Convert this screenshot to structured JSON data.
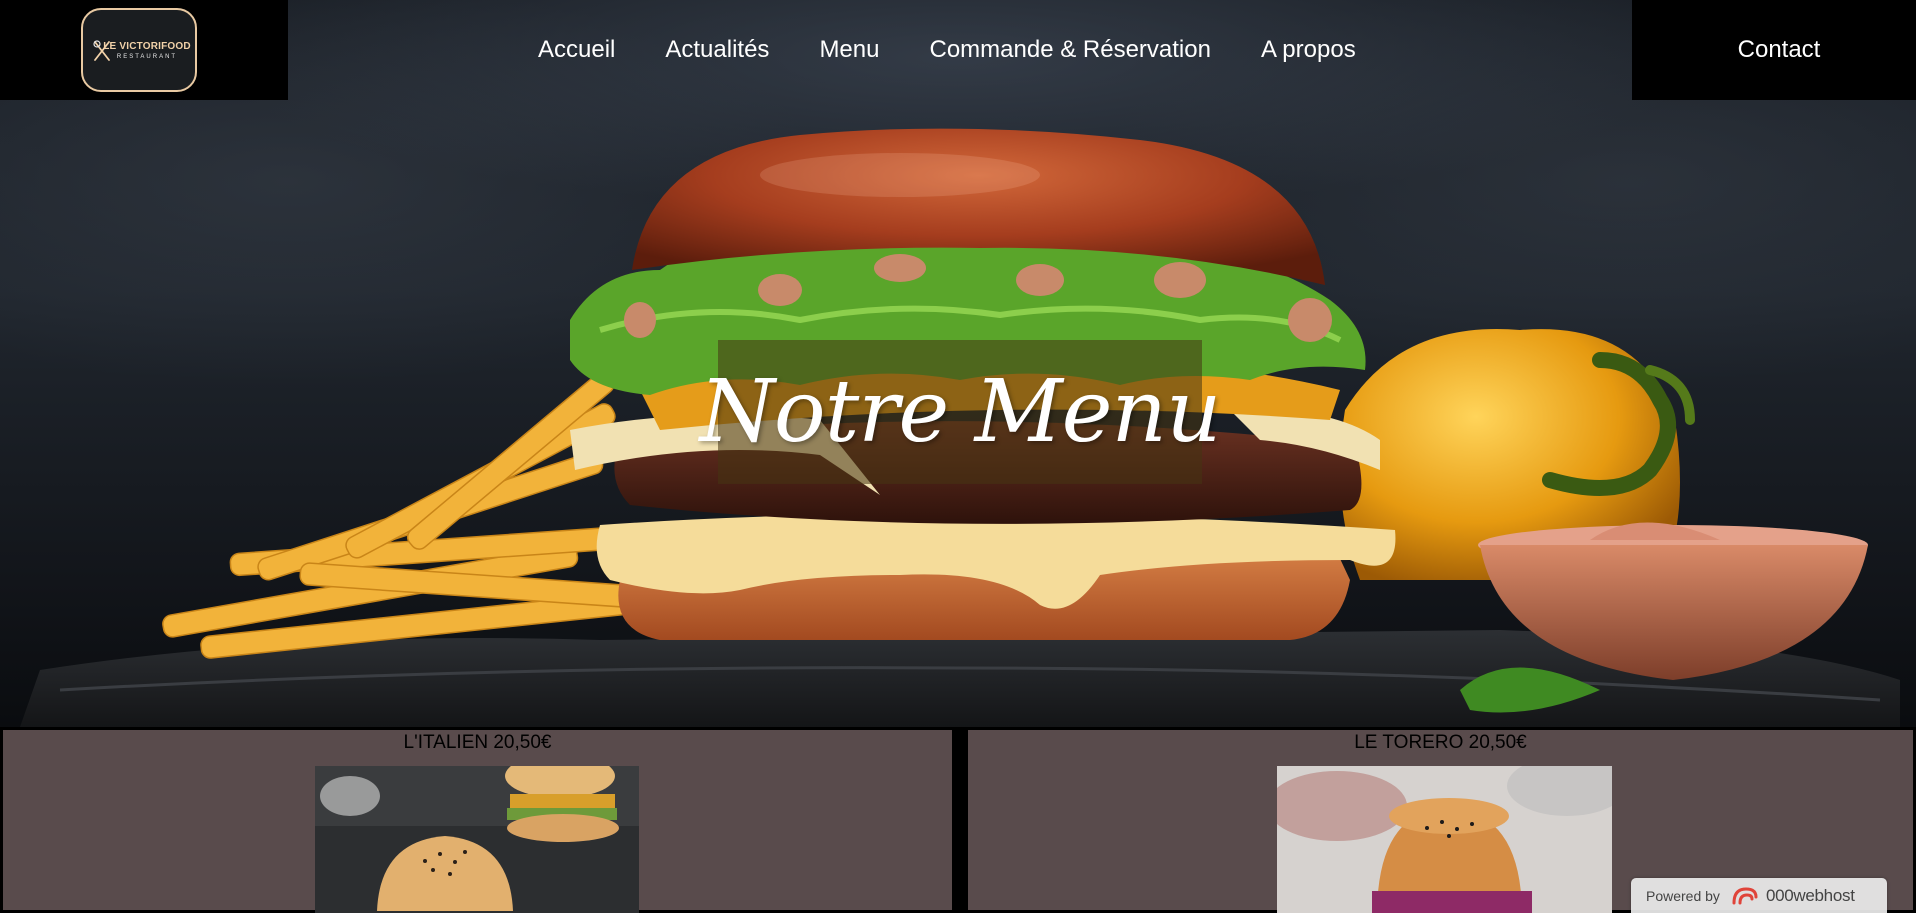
{
  "brand": {
    "logo_line1": "LE VICTORIFOOD",
    "logo_line2": "RESTAURANT"
  },
  "nav": {
    "items": [
      {
        "label": "Accueil"
      },
      {
        "label": "Actualités"
      },
      {
        "label": "Menu"
      },
      {
        "label": "Commande & Réservation"
      },
      {
        "label": "A propos"
      }
    ],
    "contact_label": "Contact"
  },
  "hero": {
    "title": "Notre Menu"
  },
  "menu_items": [
    {
      "title": "L'ITALIEN 20,50€"
    },
    {
      "title": "LE TORERO 20,50€"
    }
  ],
  "footer_badge": {
    "label": "Powered by",
    "brand": "000webhost"
  },
  "colors": {
    "nav_bg": "#000000",
    "card_bg": "#594b4c",
    "title_panel": "#46341280",
    "logo_accent": "#e8c9a2"
  }
}
